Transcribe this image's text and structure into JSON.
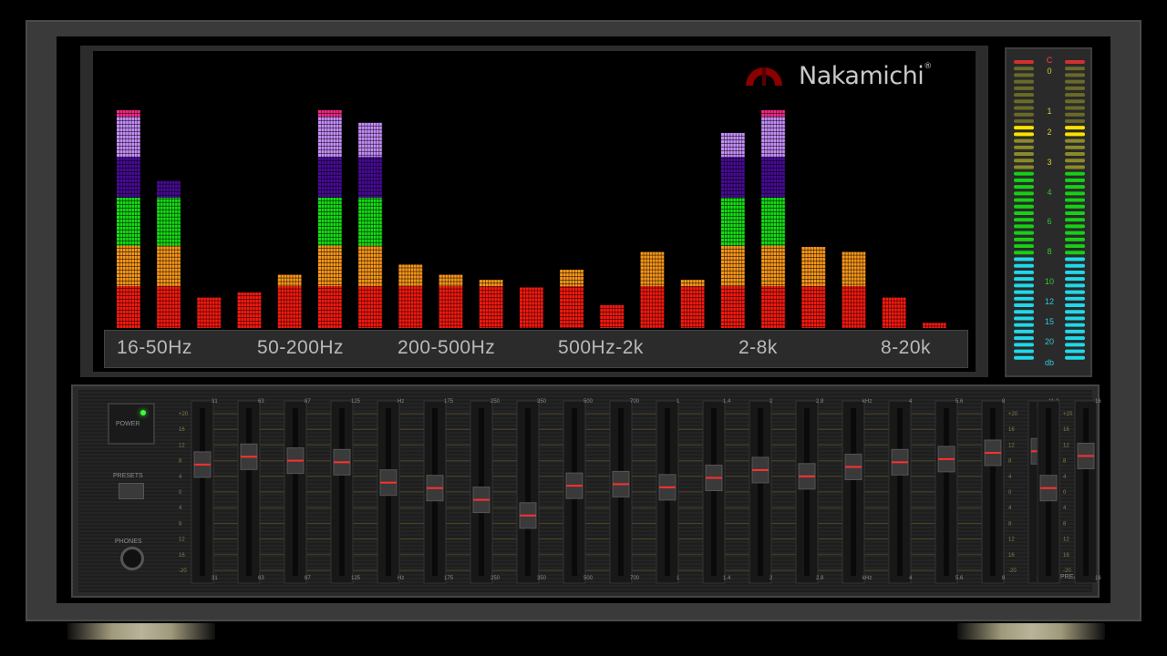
{
  "brand": {
    "name": "Nakamichi",
    "reg": "®"
  },
  "spectrum": {
    "band_labels": [
      "16-50Hz",
      "50-200Hz",
      "200-500Hz",
      "500Hz-2k",
      "2-8k",
      "8-20k"
    ],
    "bar_levels": [
      0.86,
      0.58,
      0.12,
      0.14,
      0.21,
      0.86,
      0.81,
      0.25,
      0.21,
      0.19,
      0.16,
      0.23,
      0.09,
      0.3,
      0.19,
      0.77,
      0.86,
      0.32,
      0.3,
      0.12,
      0.02
    ],
    "zone_colors": [
      "#ff1a10",
      "#ff9a1a",
      "#16e016",
      "#4a0b9a",
      "#c890ff",
      "#ff2a8a"
    ]
  },
  "vu_meter": {
    "scale": [
      "C",
      "0",
      "1",
      "2",
      "3",
      "4",
      "6",
      "8",
      "10",
      "12",
      "15",
      "20",
      "db"
    ]
  },
  "eq": {
    "power_label": "POWER",
    "presets_label": "PRESETS",
    "phones_label": "PHONES",
    "preamp_label": "PREAMP",
    "freq_labels": [
      "31",
      "63",
      "87",
      "125",
      "Hz",
      "175",
      "250",
      "350",
      "500",
      "700",
      "1",
      "1.4",
      "2",
      "2.8",
      "kHz",
      "4",
      "5.6",
      "8",
      "11.2",
      "16"
    ],
    "slider_values": [
      0.35,
      0.45,
      0.4,
      0.38,
      0.12,
      0.05,
      -0.1,
      -0.3,
      0.08,
      0.1,
      0.06,
      0.18,
      0.28,
      0.2,
      0.32,
      0.38,
      0.42,
      0.5,
      0.52,
      0.46
    ],
    "preamp_value": 0.05,
    "scale": [
      "+20",
      "16",
      "12",
      "8",
      "4",
      "0",
      "4",
      "8",
      "12",
      "16",
      "-20"
    ]
  }
}
